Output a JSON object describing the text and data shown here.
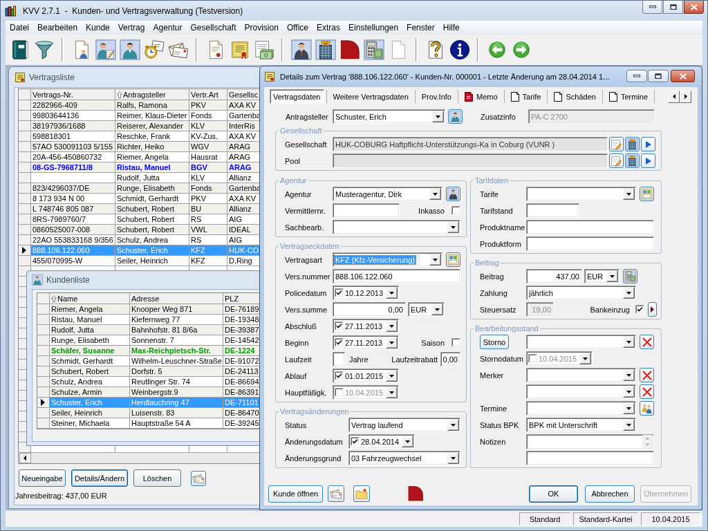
{
  "window": {
    "title": "KVV 2.7.1  -  Kunden- und Vertragsverwaltung (Testversion)"
  },
  "menu": [
    "Datei",
    "Bearbeiten",
    "Kunde",
    "Vertrag",
    "Agentur",
    "Gesellschaft",
    "Provision",
    "Office",
    "Extras",
    "Einstellungen",
    "Fenster",
    "Hilfe"
  ],
  "vertragsliste": {
    "title": "Vertragsliste",
    "columns": [
      {
        "label": "Vertrags-Nr.",
        "sorted": false
      },
      {
        "label": "Antragsteller",
        "sorted": true
      },
      {
        "label": "Vertr.Art",
        "sorted": false
      },
      {
        "label": "Gesellsc",
        "sorted": false
      }
    ],
    "rows": [
      {
        "vertrags_nr": "2282966-409",
        "antragsteller": "Ralfs, Ramona",
        "art": "PKV",
        "gesellschaft": "AXA KV",
        "selected": false,
        "bold": false
      },
      {
        "vertrags_nr": "99803644136",
        "antragsteller": "Reimer, Klaus-Dieter",
        "art": "Fonds",
        "gesellschaft": "Gartenba",
        "selected": false,
        "bold": false
      },
      {
        "vertrags_nr": "38197936/1688",
        "antragsteller": "Reiserer, Alexander",
        "art": "KLV",
        "gesellschaft": "InterRis",
        "selected": false,
        "bold": false
      },
      {
        "vertrags_nr": "598818301",
        "antragsteller": "Reschke, Frank",
        "art": "KV-Zus.",
        "gesellschaft": "AXA KV",
        "selected": false,
        "bold": false
      },
      {
        "vertrags_nr": "57AO 530091103 5/155",
        "antragsteller": "Richter, Heiko",
        "art": "WGV",
        "gesellschaft": "ARAG",
        "selected": false,
        "bold": false
      },
      {
        "vertrags_nr": "20A-456-450860732",
        "antragsteller": "Riemer, Angela",
        "art": "Hausrat",
        "gesellschaft": "ARAG",
        "selected": false,
        "bold": false
      },
      {
        "vertrags_nr": "08-GS-7968711/8",
        "antragsteller": "Ristau, Manuel",
        "art": "BGV",
        "gesellschaft": "ARAG",
        "selected": false,
        "bold": true,
        "color": "#0000ff"
      },
      {
        "antragsteller": "Rudolf, Jutta",
        "art": "KLV",
        "gesellschaft": "Allianz",
        "selected": false,
        "bold": false
      },
      {
        "vertrags_nr": "823/4296037/DE",
        "antragsteller": "Runge, Elisabeth",
        "art": "Fonds",
        "gesellschaft": "Gartenba",
        "selected": false,
        "bold": false
      },
      {
        "vertrags_nr": "8 173 934 N 00",
        "antragsteller": "Schmidt, Gerhardt",
        "art": "PKV",
        "gesellschaft": "AXA KV",
        "selected": false,
        "bold": false
      },
      {
        "vertrags_nr": "L 748746 805 087",
        "antragsteller": "Schubert, Robert",
        "art": "BU",
        "gesellschaft": "Allianz",
        "selected": false,
        "bold": false
      },
      {
        "vertrags_nr": "8RS-7989760/7",
        "antragsteller": "Schubert, Robert",
        "art": "RS",
        "gesellschaft": "AIG",
        "selected": false,
        "bold": false
      },
      {
        "vertrags_nr": "0860525007-008",
        "antragsteller": "Schubert, Robert",
        "art": "VWL",
        "gesellschaft": "IDEAL",
        "selected": false,
        "bold": false
      },
      {
        "vertrags_nr": "22AO 553833168 9/356",
        "antragsteller": "Schulz, Andrea",
        "art": "RS",
        "gesellschaft": "AIG",
        "selected": false,
        "bold": false
      },
      {
        "vertrags_nr": "888.106.122.060",
        "antragsteller": "Schuster, Erich",
        "art": "KFZ",
        "gesellschaft": "HUK-CO",
        "selected": true,
        "bold": false
      },
      {
        "vertrags_nr": "455/070995-W",
        "antragsteller": "Seiler, Heinrich",
        "art": "KFZ",
        "gesellschaft": "D.Ring",
        "selected": false,
        "bold": false
      }
    ],
    "buttons": [
      {
        "label": "Neueingabe",
        "focused": false
      },
      {
        "label": "Details/Ändern",
        "focused": true
      },
      {
        "label": "Löschen",
        "focused": false
      }
    ],
    "summary": "Jahresbeitrag: 437,00 EUR"
  },
  "kundenliste": {
    "title": "Kundenliste",
    "columns": [
      {
        "label": "Name",
        "sorted": true
      },
      {
        "label": "Adresse",
        "sorted": false
      },
      {
        "label": "PLZ",
        "sorted": false
      }
    ],
    "rows": [
      {
        "name": "Riemer, Angela",
        "adresse": "Knooper Weg 871",
        "plz": "DE-76189",
        "selected": false,
        "bold": false
      },
      {
        "name": "Ristau, Manuel",
        "adresse": "Kiefernweg 77",
        "plz": "DE-19348",
        "selected": false,
        "bold": false
      },
      {
        "name": "Rudolf, Jutta",
        "adresse": "Bahnhofstr. 81 8/6a",
        "plz": "DE-39387",
        "selected": false,
        "bold": false
      },
      {
        "name": "Runge, Elisabeth",
        "adresse": "Sonnenstr. 7",
        "plz": "DE-14542",
        "selected": false,
        "bold": false
      },
      {
        "name": "Schäfer, Susanne",
        "adresse": "Max-Reichpietsch-Str.",
        "plz": "DE-1224",
        "selected": false,
        "bold": true,
        "color": "#00a000"
      },
      {
        "name": "Schmidt, Gerhardt",
        "adresse": "Wilhelm-Leuschner-Straße",
        "plz": "DE-91072",
        "selected": false,
        "bold": false
      },
      {
        "name": "Schubert, Robert",
        "adresse": "Dorfstr. 5",
        "plz": "DE-24113",
        "selected": false,
        "bold": false
      },
      {
        "name": "Schulz, Andrea",
        "adresse": "Reutlinger Str. 74",
        "plz": "DE-86694",
        "selected": false,
        "bold": false
      },
      {
        "name": "Schulze, Armin",
        "adresse": "Weinbergstr.9",
        "plz": "DE-86391",
        "selected": false,
        "bold": false
      },
      {
        "name": "Schuster, Erich",
        "adresse": "Herdlauchring 47",
        "plz": "DE-71101",
        "selected": true,
        "bold": false
      },
      {
        "name": "Seiler, Heinrich",
        "adresse": "Luisenstr. 83",
        "plz": "DE-86470",
        "selected": false,
        "bold": false
      },
      {
        "name": "Steiner, Michaela",
        "adresse": "Hauptstraße 54 A",
        "plz": "DE-39245",
        "selected": false,
        "bold": false
      }
    ]
  },
  "details": {
    "title": "Details zum Vertrag '888.106.122.060' - Kunden-Nr. 000001 - Letzte Änderung am 28.04.2014 1...",
    "tabs": [
      {
        "label": "Vertragsdaten",
        "kind": "text",
        "selected": true
      },
      {
        "label": "Weitere Vertragsdaten",
        "kind": "text",
        "selected": false
      },
      {
        "label": "Prov.Info",
        "kind": "text",
        "selected": false
      },
      {
        "label": "Memo",
        "kind": "memo",
        "selected": false
      },
      {
        "label": "Tarife",
        "kind": "page",
        "selected": false
      },
      {
        "label": "Schäden",
        "kind": "page",
        "selected": false
      },
      {
        "label": "Termine",
        "kind": "page",
        "selected": false
      }
    ],
    "antragsteller": {
      "label": "Antragsteller",
      "value": "Schuster, Erich"
    },
    "zusatzinfo": {
      "label": "Zusatzinfo",
      "value": "PA-C 2700",
      "disabled": true
    },
    "gesellschaft": {
      "title": "Gesellschaft",
      "gesellschaft": {
        "label": "Gesellschaft",
        "value": "HUK-COBURG Haftpflicht-Unterstützungs-Ka in Coburg (VUNR )"
      },
      "pool": {
        "label": "Pool"
      }
    },
    "agentur": {
      "title": "Agentur",
      "agentur": {
        "label": "Agentur",
        "value": "Musteragentur, Dirk"
      },
      "vermittlernr": {
        "label": "Vermittlernr."
      },
      "inkasso": {
        "label": "Inkasso",
        "checked": false
      },
      "sachbearb": {
        "label": "Sachbearb."
      }
    },
    "vertragseckdaten": {
      "title": "Vertragseckdaten",
      "vertragsart": {
        "label": "Vertragsart",
        "value": "KFZ (Kfz-Versicherung)",
        "focused": true
      },
      "vers_nummer": {
        "label": "Vers.nummer",
        "value": "888.106.122.060"
      },
      "policedatum": {
        "label": "Policedatum",
        "value": "10.12.2013",
        "checked": true
      },
      "vers_summe": {
        "label": "Vers.summe",
        "value": "0,00",
        "currency": "EUR"
      },
      "abschluss": {
        "label": "Abschluß",
        "value": "27.11.2013",
        "checked": true
      },
      "beginn": {
        "label": "Beginn",
        "value": "27.11.2013",
        "checked": true
      },
      "saison": {
        "label": "Saison",
        "checked": false
      },
      "laufzeit": {
        "label": "Laufzeit",
        "unit": "Jahre"
      },
      "laufzeitrabatt": {
        "label": "Laufzeitrabatt",
        "value": "0,00"
      },
      "ablauf": {
        "label": "Ablauf",
        "value": "01.01.2015",
        "checked": true
      },
      "hauptfaelligkeit": {
        "label": "Hauptfälligk.",
        "value": "10.04.2015",
        "checked": false
      }
    },
    "vertragsaenderungen": {
      "title": "Vertragsänderungen",
      "status": {
        "label": "Status",
        "value": "Vertrag laufend"
      },
      "aenderungsdatum": {
        "label": "Änderungsdatum",
        "value": "28.04.2014",
        "checked": true
      },
      "aenderungsgrund": {
        "label": "Änderungsgrund",
        "value": "03 Fahrzeugwechsel"
      }
    },
    "tarifdaten": {
      "title": "Tarifdaten",
      "tarife": {
        "label": "Tarife"
      },
      "tarifstand": {
        "label": "Tarifstand"
      },
      "produktname": {
        "label": "Produktname"
      },
      "produktform": {
        "label": "Produktform"
      }
    },
    "beitrag": {
      "title": "Beitrag",
      "beitrag": {
        "label": "Beitrag",
        "value": "437,00",
        "currency": "EUR"
      },
      "zahlung": {
        "label": "Zahlung",
        "value": "jährlich"
      },
      "steuersatz": {
        "label": "Steuersatz",
        "value": "19,00",
        "disabled": true
      },
      "bankeinzug": {
        "label": "Bankeinzug",
        "checked": true
      }
    },
    "bearbeitungsstand": {
      "title": "Bearbeitungsstand",
      "storno": {
        "button": "Storno"
      },
      "stornodatum": {
        "label": "Stornodatum",
        "value": "10.04.2015",
        "checked": false
      },
      "merker": {
        "label": "Merker"
      },
      "termine": {
        "label": "Termine"
      },
      "status_bpk": {
        "label": "Status BPK",
        "value": "BPK mit Unterschrift"
      },
      "notizen": {
        "label": "Notizen"
      }
    },
    "open_button": "Kunde öffnen",
    "buttons": [
      {
        "label": "OK",
        "default": true,
        "disabled": false
      },
      {
        "label": "Abbrechen",
        "default": false,
        "disabled": false
      },
      {
        "label": "Übernehmen",
        "default": false,
        "disabled": true
      }
    ]
  },
  "status_bar": [
    "Standard",
    "Standard-Kartei",
    "10.04.2015"
  ]
}
